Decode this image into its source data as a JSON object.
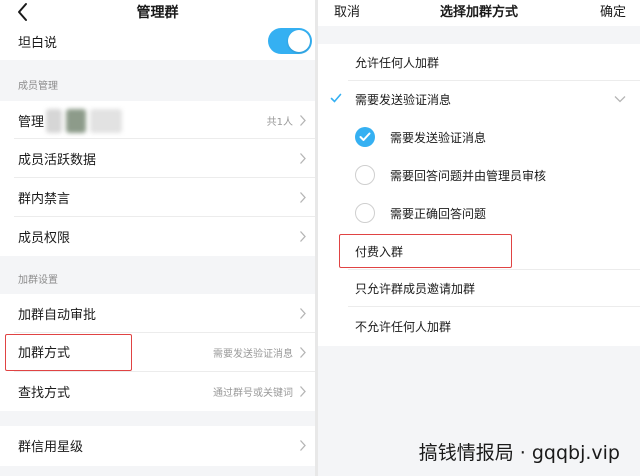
{
  "left": {
    "title": "管理群",
    "rows": {
      "tanbai": {
        "label": "坦白说"
      },
      "admin": {
        "label": "管理",
        "value": "共1人"
      },
      "activity": {
        "label": "成员活跃数据"
      },
      "mute": {
        "label": "群内禁言"
      },
      "perm": {
        "label": "成员权限"
      },
      "autoapprove": {
        "label": "加群自动审批"
      },
      "joinmethod": {
        "label": "加群方式",
        "value": "需要发送验证消息"
      },
      "findmethod": {
        "label": "查找方式",
        "value": "通过群号或关键词"
      },
      "credit": {
        "label": "群信用星级"
      }
    },
    "sections": {
      "members": "成员管理",
      "join": "加群设置"
    },
    "toggle_on": true
  },
  "right": {
    "cancel": "取消",
    "title": "选择加群方式",
    "confirm": "确定",
    "options": {
      "anyone": "允许任何人加群",
      "verify": "需要发送验证消息",
      "paid": "付费入群",
      "invite": "只允许群成员邀请加群",
      "none": "不允许任何人加群"
    },
    "suboptions": {
      "s1": "需要发送验证消息",
      "s2": "需要回答问题并由管理员审核",
      "s3": "需要正确回答问题"
    }
  },
  "watermark": "搞钱情报局 · gqqbj.vip",
  "colors": {
    "accent": "#35b0f2",
    "highlight": "#e04343",
    "section_bg": "#f4f5f7"
  }
}
